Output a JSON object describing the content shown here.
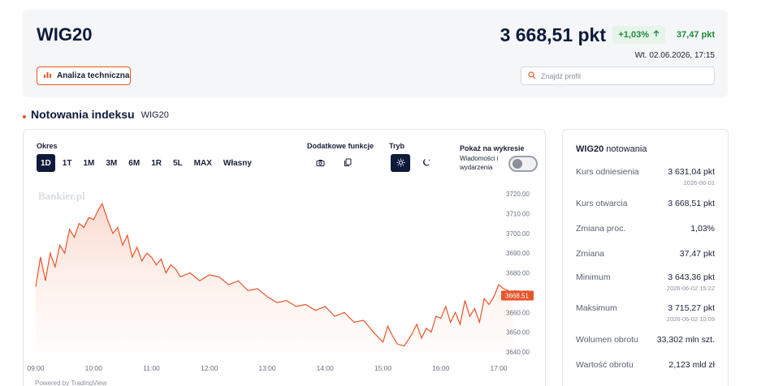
{
  "header": {
    "index_name": "WIG20",
    "price": "3 668,51 pkt",
    "change_pct": "+1,03%",
    "change_abs": "37,47 pkt",
    "timestamp": "Wt. 02.06.2026, 17:15",
    "ta_button": "Analiza techniczna",
    "search_placeholder": "Znajdź profil"
  },
  "section": {
    "title": "Notowania indeksu",
    "subtitle": "WIG20"
  },
  "controls": {
    "period_label": "Okres",
    "periods": [
      "1D",
      "1T",
      "1M",
      "3M",
      "6M",
      "1R",
      "5L",
      "MAX",
      "Własny"
    ],
    "active_period": "1D",
    "extra_label": "Dodatkowe funkcje",
    "mode_label": "Tryb",
    "show_label": "Pokaż na wykresie",
    "news_label": "Wiadomości i wydarzenia"
  },
  "chart_data": {
    "type": "area",
    "watermark": "Bankier.pl",
    "powered_by": "Powered by TradingView",
    "x_ticks": [
      "09:00",
      "10:00",
      "11:00",
      "12:00",
      "13:00",
      "14:00",
      "15:00",
      "16:00",
      "17:00"
    ],
    "y_ticks": [
      "3720.00",
      "3710.00",
      "3700.00",
      "3690.00",
      "3680.00",
      "3670.00",
      "3660.00",
      "3650.00",
      "3640.00"
    ],
    "ylim": [
      3640,
      3720
    ],
    "last_label": "3668.51",
    "x": [
      "09:00",
      "09:05",
      "09:10",
      "09:15",
      "09:20",
      "09:25",
      "09:30",
      "09:35",
      "09:40",
      "09:45",
      "09:50",
      "09:55",
      "10:00",
      "10:05",
      "10:09",
      "10:15",
      "10:20",
      "10:25",
      "10:30",
      "10:35",
      "10:40",
      "10:45",
      "10:50",
      "10:55",
      "11:00",
      "11:05",
      "11:10",
      "11:15",
      "11:20",
      "11:25",
      "11:30",
      "11:40",
      "11:50",
      "12:00",
      "12:10",
      "12:20",
      "12:30",
      "12:40",
      "12:50",
      "13:00",
      "13:10",
      "13:20",
      "13:30",
      "13:40",
      "13:50",
      "14:00",
      "14:10",
      "14:20",
      "14:30",
      "14:40",
      "14:50",
      "15:00",
      "15:05",
      "15:10",
      "15:15",
      "15:22",
      "15:30",
      "15:35",
      "15:40",
      "15:45",
      "15:50",
      "15:55",
      "16:00",
      "16:05",
      "16:10",
      "16:15",
      "16:20",
      "16:25",
      "16:30",
      "16:35",
      "16:40",
      "16:45",
      "16:50",
      "16:55",
      "17:00",
      "17:05",
      "17:10",
      "17:15"
    ],
    "y": [
      3673,
      3688,
      3676,
      3690,
      3683,
      3694,
      3690,
      3702,
      3698,
      3705,
      3703,
      3708,
      3707,
      3712,
      3715,
      3706,
      3700,
      3703,
      3694,
      3699,
      3688,
      3693,
      3686,
      3690,
      3688,
      3684,
      3687,
      3680,
      3684,
      3682,
      3678,
      3680,
      3676,
      3679,
      3678,
      3674,
      3676,
      3671,
      3672,
      3668,
      3665,
      3666,
      3663,
      3664,
      3661,
      3663,
      3658,
      3660,
      3655,
      3656,
      3650,
      3645,
      3653,
      3648,
      3644,
      3643,
      3649,
      3654,
      3647,
      3652,
      3650,
      3658,
      3657,
      3663,
      3655,
      3660,
      3654,
      3666,
      3658,
      3662,
      3655,
      3667,
      3664,
      3668,
      3674,
      3672,
      3671,
      3668.51
    ],
    "series": [
      {
        "name": "WIG20"
      }
    ]
  },
  "stats": {
    "title_bold": "WIG20",
    "title_rest": "notowania",
    "rows": [
      {
        "label": "Kurs odniesienia",
        "value": "3 631,04 pkt",
        "date": "2026-06-01"
      },
      {
        "label": "Kurs otwarcia",
        "value": "3 668,51 pkt",
        "date": ""
      },
      {
        "label": "Zmiana proc.",
        "value": "1,03%",
        "date": ""
      },
      {
        "label": "Zmiana",
        "value": "37,47 pkt",
        "date": ""
      },
      {
        "label": "Minimum",
        "value": "3 643,36 pkt",
        "date": "2026-06-02 15:22"
      },
      {
        "label": "Maksimum",
        "value": "3 715,27 pkt",
        "date": "2026-06-02 10:09"
      },
      {
        "label": "Wolumen obrotu",
        "value": "33,302 mln szt.",
        "date": ""
      },
      {
        "label": "Wartość obrotu",
        "value": "2,123 mld zł",
        "date": ""
      }
    ]
  },
  "colors": {
    "accent": "#e8552b",
    "positive": "#1f8a3e",
    "dark": "#0e1a3a"
  }
}
